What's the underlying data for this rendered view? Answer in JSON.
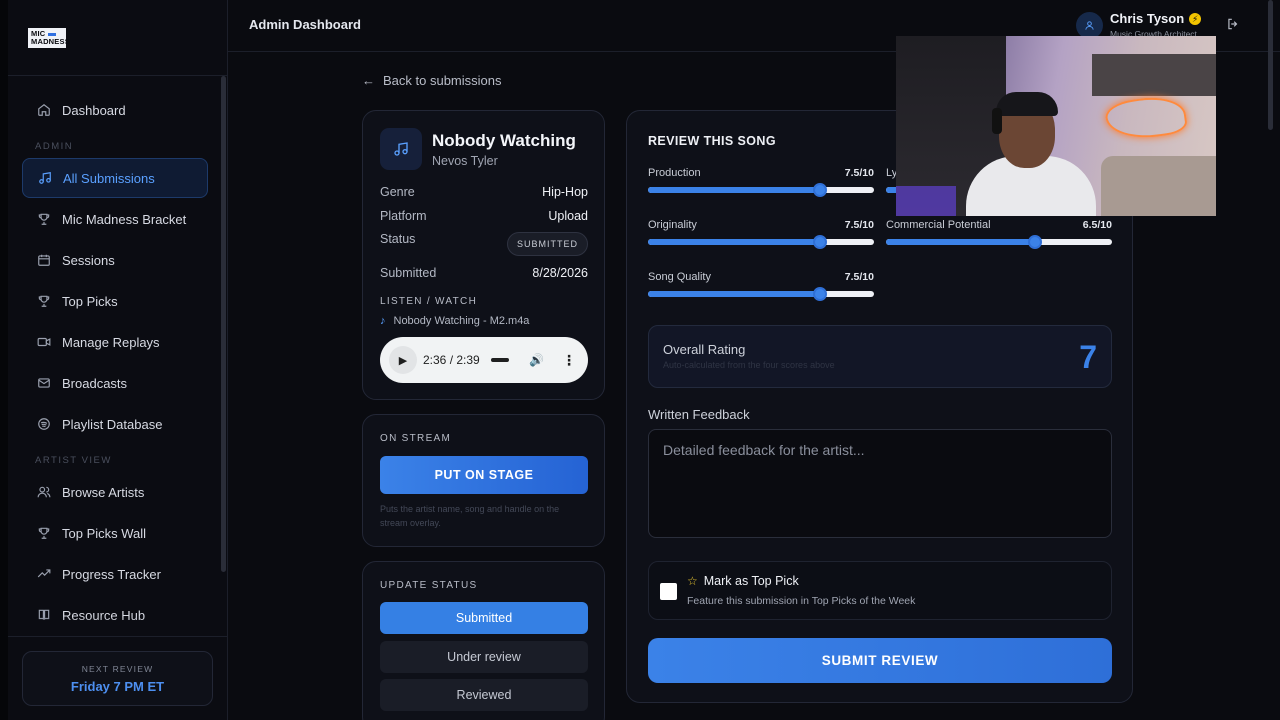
{
  "sidebar": {
    "logo": {
      "line1": "MIC",
      "line2": "MADNESS"
    },
    "items_top": [
      {
        "label": "Dashboard",
        "icon": "home-icon"
      }
    ],
    "section_admin": "ADMIN",
    "items_admin": [
      {
        "label": "All Submissions",
        "icon": "music-note-icon",
        "active": true
      },
      {
        "label": "Mic Madness Bracket",
        "icon": "trophy-icon"
      },
      {
        "label": "Sessions",
        "icon": "calendar-icon"
      },
      {
        "label": "Top Picks",
        "icon": "trophy-icon"
      },
      {
        "label": "Manage Replays",
        "icon": "video-icon"
      },
      {
        "label": "Broadcasts",
        "icon": "mail-icon"
      },
      {
        "label": "Playlist Database",
        "icon": "spotify-icon"
      }
    ],
    "section_artist": "ARTIST VIEW",
    "items_artist": [
      {
        "label": "Browse Artists",
        "icon": "users-icon"
      },
      {
        "label": "Top Picks Wall",
        "icon": "trophy-icon"
      },
      {
        "label": "Progress Tracker",
        "icon": "trending-up-icon"
      },
      {
        "label": "Resource Hub",
        "icon": "book-icon"
      }
    ],
    "next_review": {
      "label": "NEXT REVIEW",
      "value": "Friday 7 PM ET"
    }
  },
  "header": {
    "title": "Admin Dashboard",
    "user_name": "Chris Tyson",
    "user_role": "Music Growth Architect"
  },
  "back_link": "Back to submissions",
  "song": {
    "title": "Nobody Watching",
    "artist": "Nevos Tyler",
    "meta": [
      {
        "label": "Genre",
        "value": "Hip-Hop"
      },
      {
        "label": "Platform",
        "value": "Upload"
      },
      {
        "label": "Status",
        "value": "SUBMITTED"
      },
      {
        "label": "Submitted",
        "value": "8/28/2026"
      }
    ],
    "listen_label": "LISTEN / WATCH",
    "file_name": "Nobody Watching - M2.m4a",
    "player_time": "2:36 / 2:39",
    "player_progress": 0.98
  },
  "stream": {
    "label": "ON STREAM",
    "button": "PUT ON STAGE",
    "hint": "Puts the artist name, song and handle on the stream overlay."
  },
  "update_status": {
    "label": "UPDATE STATUS",
    "options": [
      "Submitted",
      "Under review",
      "Reviewed"
    ],
    "selected": "Submitted"
  },
  "review": {
    "title": "REVIEW THIS SONG",
    "sliders": [
      {
        "name": "Production",
        "value_text": "7.5/10",
        "value": 7.5
      },
      {
        "name": "Ly",
        "value_text": "",
        "value": 7.5
      },
      {
        "name": "Originality",
        "value_text": "7.5/10",
        "value": 7.5
      },
      {
        "name": "Commercial Potential",
        "value_text": "6.5/10",
        "value": 6.5
      },
      {
        "name": "Song Quality",
        "value_text": "7.5/10",
        "value": 7.5
      }
    ],
    "overall": {
      "label": "Overall Rating",
      "sub": "Auto-calculated from the four scores above",
      "value": "7"
    },
    "feedback_label": "Written Feedback",
    "feedback_placeholder": "Detailed feedback for the artist...",
    "top_pick": {
      "title": "Mark as Top Pick",
      "desc": "Feature this submission in Top Picks of the Week"
    },
    "submit": "SUBMIT REVIEW"
  },
  "colors": {
    "accent": "#3b82e8",
    "background": "#0a0b10",
    "card": "#0e1018"
  }
}
